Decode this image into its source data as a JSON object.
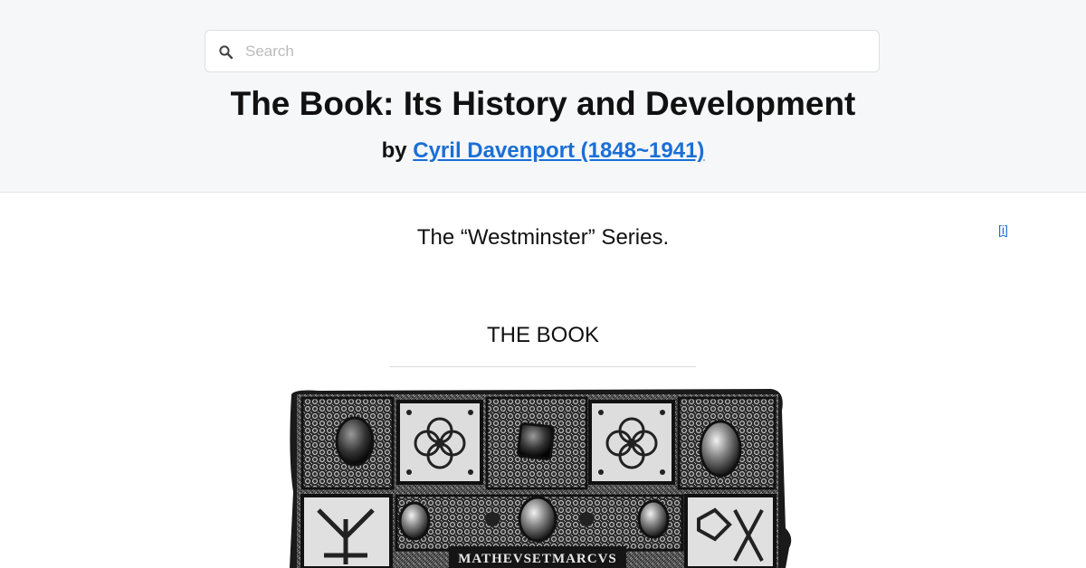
{
  "search": {
    "placeholder": "Search"
  },
  "book": {
    "title": "The Book: Its History and Development",
    "by_label": "by",
    "author": "Cyril Davenport (1848~1941)"
  },
  "content": {
    "info_link": "[i]",
    "series": "The “Westminster” Series.",
    "section_title": "THE BOOK"
  },
  "frontispiece": {
    "inscription": "MATHEVSETMARCVS"
  },
  "icons": {
    "search": "search-icon"
  },
  "colors": {
    "link": "#1a6fd6",
    "header_bg": "#f6f7f9"
  }
}
